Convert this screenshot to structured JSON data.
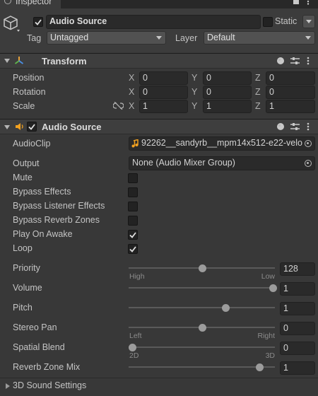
{
  "window": {
    "tab_title": "Inspector"
  },
  "gameobject": {
    "name": "Audio Source",
    "static_label": "Static",
    "tag_label": "Tag",
    "tag_value": "Untagged",
    "layer_label": "Layer",
    "layer_value": "Default"
  },
  "transform": {
    "title": "Transform",
    "rows": [
      {
        "label": "Position",
        "x": "0",
        "y": "0",
        "z": "0"
      },
      {
        "label": "Rotation",
        "x": "0",
        "y": "0",
        "z": "0"
      },
      {
        "label": "Scale",
        "x": "1",
        "y": "1",
        "z": "1"
      }
    ],
    "axis_x": "X",
    "axis_y": "Y",
    "axis_z": "Z"
  },
  "audio_source": {
    "title": "Audio Source",
    "clip_label": "AudioClip",
    "clip_value": "92262__sandyrb__mpm14x512-e22-velo",
    "output_label": "Output",
    "output_value": "None (Audio Mixer Group)",
    "toggles": [
      {
        "label": "Mute",
        "checked": false
      },
      {
        "label": "Bypass Effects",
        "checked": false
      },
      {
        "label": "Bypass Listener Effects",
        "checked": false
      },
      {
        "label": "Bypass Reverb Zones",
        "checked": false
      },
      {
        "label": "Play On Awake",
        "checked": true
      },
      {
        "label": "Loop",
        "checked": true
      }
    ],
    "sliders": {
      "priority": {
        "label": "Priority",
        "value": "128",
        "fraction": 0.5,
        "left": "High",
        "right": "Low"
      },
      "volume": {
        "label": "Volume",
        "value": "1",
        "fraction": 1.0
      },
      "pitch": {
        "label": "Pitch",
        "value": "1",
        "fraction": 0.667
      },
      "stereo_pan": {
        "label": "Stereo Pan",
        "value": "0",
        "fraction": 0.5,
        "left": "Left",
        "right": "Right"
      },
      "spatial_blend": {
        "label": "Spatial Blend",
        "value": "0",
        "fraction": 0.0,
        "left": "2D",
        "right": "3D"
      },
      "reverb_mix": {
        "label": "Reverb Zone Mix",
        "value": "1",
        "fraction": 0.909
      }
    },
    "sound_settings_label": "3D Sound Settings"
  },
  "colors": {
    "background": "#383838",
    "accent": "#3a7dd6",
    "transform_icon": "#e6a23c",
    "speaker_icon": "#f0a020"
  }
}
